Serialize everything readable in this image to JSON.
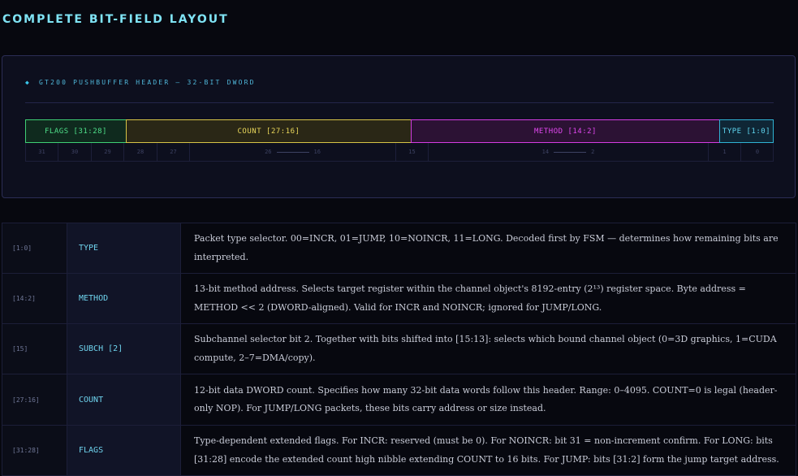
{
  "title": "COMPLETE BIT-FIELD LAYOUT",
  "panel": {
    "heading": "GT200 PUSHBUFFER HEADER — 32-BIT DWORD",
    "fields": [
      {
        "label": "FLAGS [31:28]",
        "color": "#3fcf74"
      },
      {
        "label": "COUNT [27:16]",
        "color": "#d7c447"
      },
      {
        "label": "METHOD [14:2]",
        "color": "#d43ce2"
      },
      {
        "label": "TYPE [1:0]",
        "color": "#2fb3d4"
      }
    ],
    "bits": {
      "b31": "31",
      "b30": "30",
      "b29": "29",
      "b28": "28",
      "b27": "27",
      "b26": "26",
      "b16": "16",
      "b15": "15",
      "b14": "14",
      "b2": "2",
      "b1": "1",
      "b0": "0"
    }
  },
  "table": {
    "rows": [
      {
        "bits": "[1:0]",
        "name": "TYPE",
        "description": "Packet type selector. 00=INCR, 01=JUMP, 10=NOINCR, 11=LONG. Decoded first by FSM — determines how remaining bits are interpreted."
      },
      {
        "bits": "[14:2]",
        "name": "METHOD",
        "description": "13-bit method address. Selects target register within the channel object's 8192-entry (2¹³) register space. Byte address = METHOD << 2 (DWORD-aligned). Valid for INCR and NOINCR; ignored for JUMP/LONG."
      },
      {
        "bits": "[15]",
        "name": "SUBCH [2]",
        "description": "Subchannel selector bit 2. Together with bits shifted into [15:13]: selects which bound channel object (0=3D graphics, 1=CUDA compute, 2–7=DMA/copy)."
      },
      {
        "bits": "[27:16]",
        "name": "COUNT",
        "description": "12-bit data DWORD count. Specifies how many 32-bit data words follow this header. Range: 0–4095. COUNT=0 is legal (header-only NOP). For JUMP/LONG packets, these bits carry address or size instead."
      },
      {
        "bits": "[31:28]",
        "name": "FLAGS",
        "description": "Type-dependent extended flags. For INCR: reserved (must be 0). For NOINCR: bit 31 = non-increment confirm. For LONG: bits [31:28] encode the extended count high nibble extending COUNT to 16 bits. For JUMP: bits [31:2] form the jump target address."
      }
    ]
  }
}
